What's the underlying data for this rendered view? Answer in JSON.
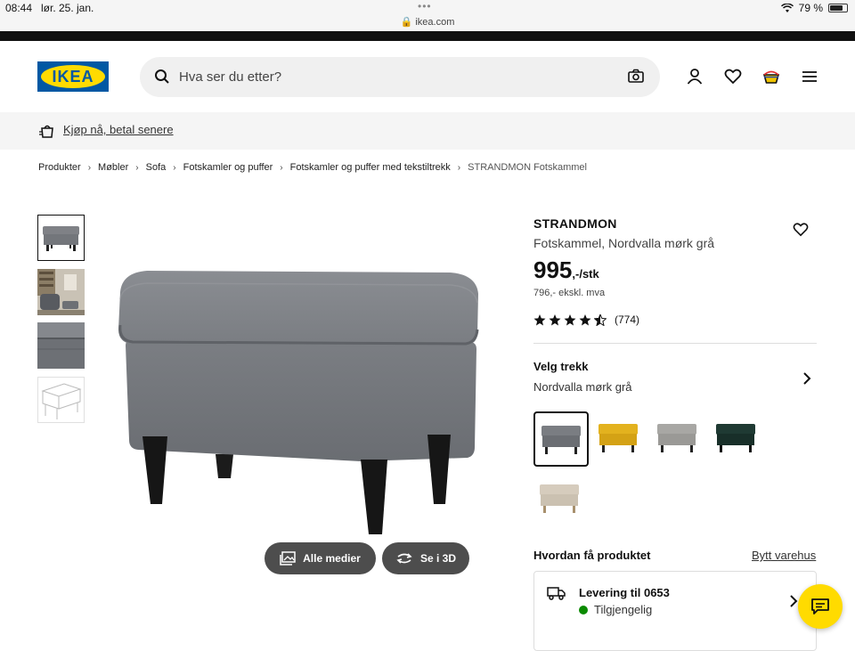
{
  "status_bar": {
    "time": "08:44",
    "date": "lør. 25. jan.",
    "url": "ikea.com",
    "battery": "79 %",
    "battery_level": 0.79
  },
  "header": {
    "logo_text": "IKEA",
    "search_placeholder": "Hva ser du etter?",
    "icons": [
      "user-icon",
      "heart-icon",
      "basket-icon",
      "menu-icon"
    ]
  },
  "promo": {
    "link": "Kjøp nå, betal senere"
  },
  "breadcrumb": {
    "items": [
      "Produkter",
      "Møbler",
      "Sofa",
      "Fotskamler og puffer",
      "Fotskamler og puffer med tekstiltrekk"
    ],
    "current": "STRANDMON Fotskammel"
  },
  "gallery": {
    "buttons": {
      "all_media": "Alle medier",
      "view_3d": "Se i 3D"
    }
  },
  "product": {
    "name": "STRANDMON",
    "description": "Fotskammel, Nordvalla mørk grå",
    "price": "995",
    "price_unit": ",-/stk",
    "price_ex_vat": "796,- ekskl. mva",
    "rating": 4.5,
    "rating_count": "(774)"
  },
  "variant": {
    "label": "Velg trekk",
    "selected": "Nordvalla mørk grå",
    "swatch_colors": [
      "#7a7d82",
      "#e3b21e",
      "#a8a7a4",
      "#1f3a33",
      "#d6ccbd"
    ]
  },
  "fulfilment": {
    "title": "Hvordan få produktet",
    "change_store": "Bytt varehus",
    "delivery_title": "Levering til 0653",
    "delivery_status": "Tilgjengelig"
  },
  "colors": {
    "ikea_blue": "#0058a3",
    "ikea_yellow": "#ffdb00",
    "available_green": "#0a8a00"
  }
}
